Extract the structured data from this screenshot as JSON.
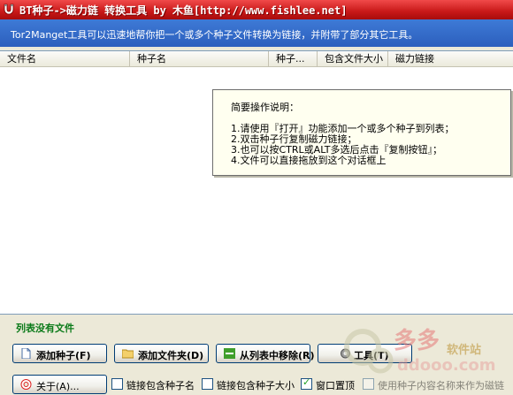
{
  "window": {
    "title": "BT种子->磁力链 转换工具 by 木鱼[http://www.fishlee.net]"
  },
  "banner": {
    "text": "Tor2Manget工具可以迅速地帮你把一个或多个种子文件转换为链接，并附带了部分其它工具。"
  },
  "list": {
    "columns": [
      "文件名",
      "种子名",
      "种子...",
      "包含文件大小",
      "磁力链接"
    ]
  },
  "info": {
    "title": "简要操作说明：",
    "lines": [
      "1.请使用『打开』功能添加一个或多个种子到列表；",
      "2.双击种子行复制磁力链接；",
      "3.也可以按CTRL或ALT多选后点击『复制按钮』；",
      "4.文件可以直接拖放到这个对话框上"
    ]
  },
  "status": "列表没有文件",
  "buttons": {
    "add_torrent": "添加种子(F)",
    "add_folder": "添加文件夹(D)",
    "remove": "从列表中移除(R)",
    "tools": "工具(T)",
    "about": "关于(A)..."
  },
  "options": [
    {
      "label": "链接包含种子名",
      "checked": false
    },
    {
      "label": "链接包含种子大小",
      "checked": false
    },
    {
      "label": "窗口置顶",
      "checked": true
    },
    {
      "label": "使用种子内容名称来作为磁链",
      "checked": false
    }
  ],
  "watermark": {
    "text1": "多多",
    "text2": "软件站",
    "text3": "ddooo.com"
  },
  "colors": {
    "title_bg": "#c81818",
    "banner_bg": "#2c5fbd",
    "status_green": "#0a7a19"
  }
}
